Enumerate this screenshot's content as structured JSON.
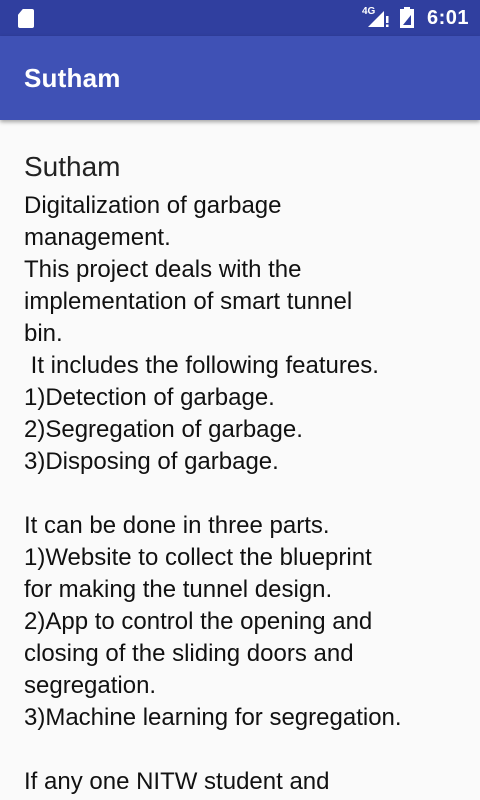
{
  "status_bar": {
    "network": "4G",
    "time": "6:01"
  },
  "app_bar": {
    "title": "Sutham"
  },
  "content": {
    "title": "Sutham",
    "body": "Digitalization of garbage\nmanagement.\nThis project deals with the\nimplementation of smart tunnel\nbin.\n It includes the following features.\n1)Detection of garbage.\n2)Segregation of garbage.\n3)Disposing of garbage.\n\nIt can be done in three parts.\n1)Website to collect the blueprint\nfor making the tunnel design.\n2)App to control the opening and\nclosing of the sliding doors and\nsegregation.\n3)Machine learning for segregation.\n\nIf any one NITW student and"
  },
  "colors": {
    "status_bar": "#303f9f",
    "app_bar": "#3f51b5",
    "background": "#fafafa"
  }
}
